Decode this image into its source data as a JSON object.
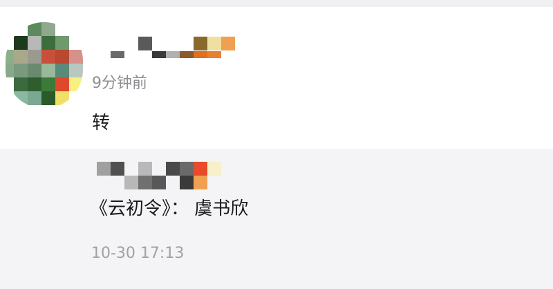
{
  "comment": {
    "time": "9分钟前",
    "text": "转"
  },
  "repost": {
    "text": "《云初令》： 虞书欣",
    "time": "10-30 17:13"
  }
}
